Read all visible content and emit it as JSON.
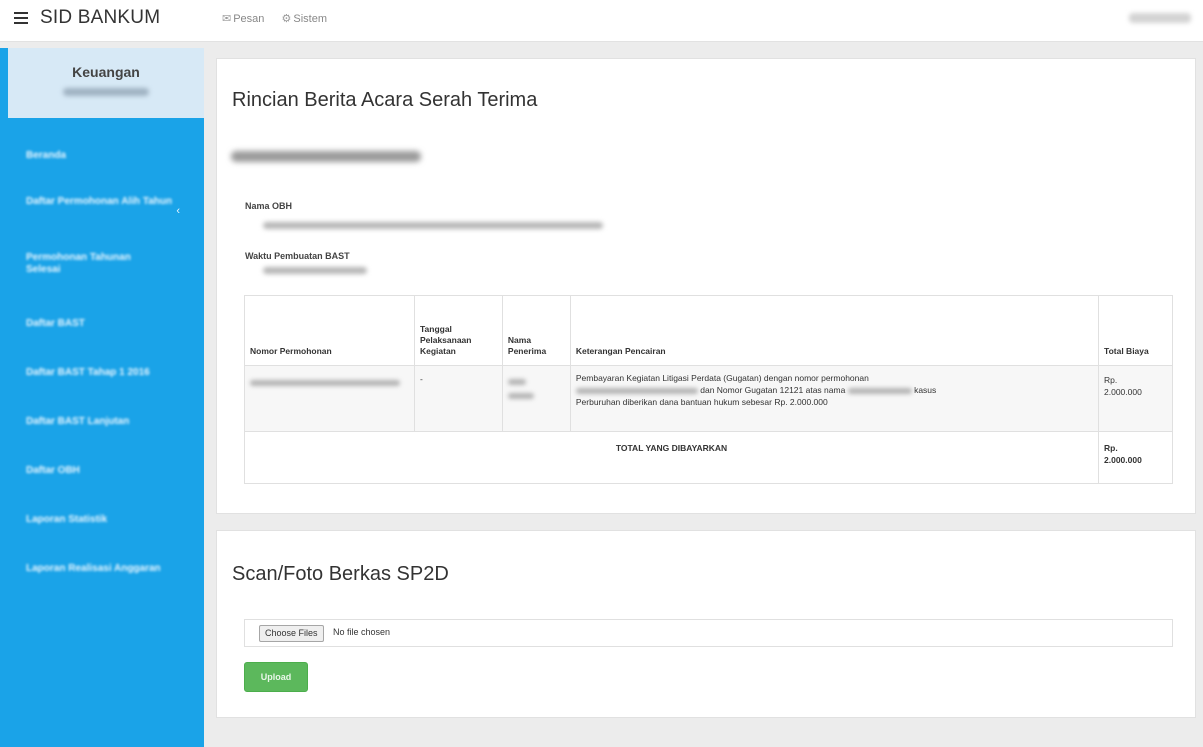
{
  "app": {
    "brand": "SID BANKUM"
  },
  "topnav": {
    "pesan": {
      "icon": "envelope-icon",
      "label": "Pesan"
    },
    "sistem": {
      "icon": "cogs-icon",
      "label": "Sistem"
    }
  },
  "sidebar": {
    "title": "Keuangan",
    "items": [
      {
        "label": "Beranda"
      },
      {
        "label": "Daftar Permohonan Alih Tahun",
        "caret": "‹"
      },
      {
        "label": "Permohonan Tahunan Selesai"
      },
      {
        "label": "Daftar BAST"
      },
      {
        "label": "Daftar BAST Tahap 1 2016"
      },
      {
        "label": "Daftar BAST Lanjutan"
      },
      {
        "label": "Daftar OBH"
      },
      {
        "label": "Laporan Statistik"
      },
      {
        "label": "Laporan Realisasi Anggaran"
      }
    ]
  },
  "detail": {
    "heading": "Rincian Berita Acara Serah Terima",
    "nama_obh_label": "Nama OBH",
    "waktu_label": "Waktu Pembuatan BAST",
    "table": {
      "headers": [
        "Nomor Permohonan",
        "Tanggal Pelaksanaan Kegiatan",
        "Nama Penerima",
        "Keterangan Pencairan",
        "Total Biaya"
      ],
      "row": {
        "tanggal": "-",
        "keterangan_1": "Pembayaran Kegiatan Litigasi Perdata (Gugatan) dengan nomor permohonan",
        "keterangan_2": "dan Nomor Gugatan 12121 atas nama",
        "keterangan_3": "kasus",
        "keterangan_4": "Perburuhan diberikan dana bantuan hukum sebesar Rp. 2.000.000",
        "biaya_1": "Rp.",
        "biaya_2": "2.000.000"
      },
      "total_label": "TOTAL YANG DIBAYARKAN",
      "total_1": "Rp.",
      "total_2": "2.000.000"
    }
  },
  "upload": {
    "heading": "Scan/Foto Berkas SP2D",
    "choose_label": "Choose Files",
    "no_file": "No file chosen",
    "button": "Upload"
  },
  "colors": {
    "sidebar": "#1aa3e8",
    "upload_button": "#5cb85c"
  }
}
